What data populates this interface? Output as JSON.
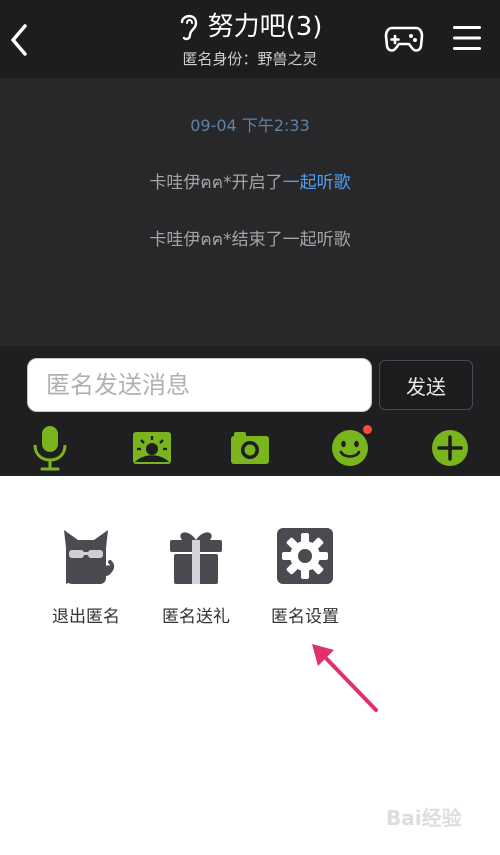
{
  "header": {
    "title": "努力吧(3)",
    "subtitle": "匿名身份：野兽之灵"
  },
  "chat": {
    "timestamp": "09-04 下午2:33",
    "messages": [
      {
        "prefix": "卡哇伊ฅฅ*开启了",
        "link": "一起听歌"
      },
      {
        "prefix": "卡哇伊ฅฅ*结束了一起听歌",
        "link": ""
      }
    ]
  },
  "input": {
    "placeholder": "匿名发送消息",
    "send_label": "发送"
  },
  "toolbar": {
    "icons": [
      "microphone-icon",
      "scene-icon",
      "camera-icon",
      "emoji-icon",
      "plus-icon"
    ],
    "accent_color": "#7ab51d",
    "badge_color": "#ff4b3a"
  },
  "panel": {
    "items": [
      {
        "label": "退出匿名",
        "icon": "masked-cat-icon"
      },
      {
        "label": "匿名送礼",
        "icon": "gift-icon"
      },
      {
        "label": "匿名设置",
        "icon": "gear-icon"
      }
    ]
  },
  "watermark": {
    "text": "Bai经验"
  }
}
